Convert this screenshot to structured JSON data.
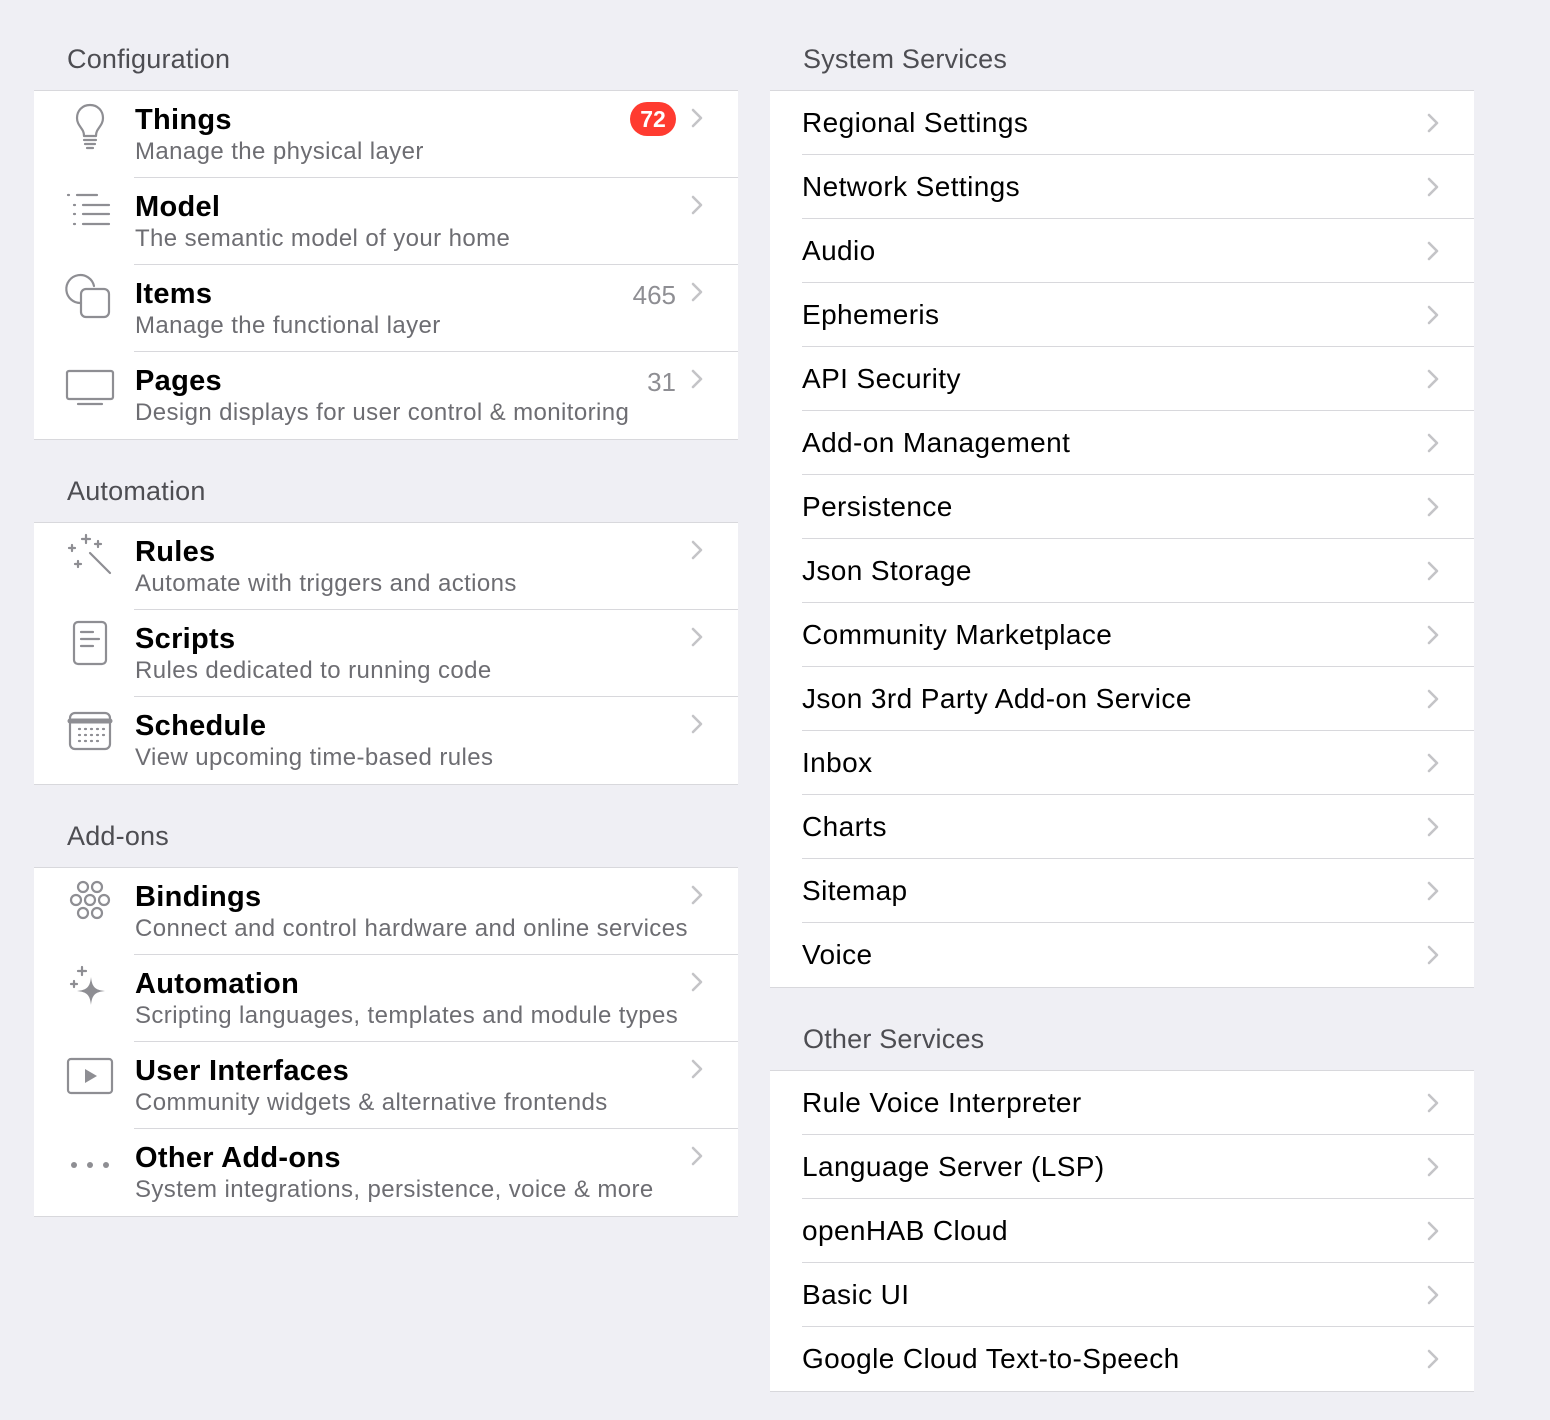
{
  "configuration": {
    "title": "Configuration",
    "items": [
      {
        "title": "Things",
        "subtitle": "Manage the physical layer",
        "badge": "72",
        "after": "",
        "icon": "lightbulb-icon"
      },
      {
        "title": "Model",
        "subtitle": "The semantic model of your home",
        "badge": "",
        "after": "",
        "icon": "list-bullet-indent-icon"
      },
      {
        "title": "Items",
        "subtitle": "Manage the functional layer",
        "badge": "",
        "after": "465",
        "icon": "square-on-circle-icon"
      },
      {
        "title": "Pages",
        "subtitle": "Design displays for user control & monitoring",
        "badge": "",
        "after": "31",
        "icon": "tv-icon"
      }
    ]
  },
  "automation": {
    "title": "Automation",
    "items": [
      {
        "title": "Rules",
        "subtitle": "Automate with triggers and actions",
        "icon": "wand-stars-icon"
      },
      {
        "title": "Scripts",
        "subtitle": "Rules dedicated to running code",
        "icon": "doc-plaintext-icon"
      },
      {
        "title": "Schedule",
        "subtitle": "View upcoming time-based rules",
        "icon": "calendar-icon"
      }
    ]
  },
  "addons": {
    "title": "Add-ons",
    "items": [
      {
        "title": "Bindings",
        "subtitle": "Connect and control hardware and online services",
        "icon": "circles-grid-icon"
      },
      {
        "title": "Automation",
        "subtitle": "Scripting languages, templates and module types",
        "icon": "sparkles-icon"
      },
      {
        "title": "User Interfaces",
        "subtitle": "Community widgets & alternative frontends",
        "icon": "play-rectangle-icon"
      },
      {
        "title": "Other Add-ons",
        "subtitle": "System integrations, persistence, voice & more",
        "icon": "ellipsis-icon"
      }
    ]
  },
  "system_services": {
    "title": "System Services",
    "items": [
      "Regional Settings",
      "Network Settings",
      "Audio",
      "Ephemeris",
      "API Security",
      "Add-on Management",
      "Persistence",
      "Json Storage",
      "Community Marketplace",
      "Json 3rd Party Add-on Service",
      "Inbox",
      "Charts",
      "Sitemap",
      "Voice"
    ]
  },
  "other_services": {
    "title": "Other Services",
    "items": [
      "Rule Voice Interpreter",
      "Language Server (LSP)",
      "openHAB Cloud",
      "Basic UI",
      "Google Cloud Text-to-Speech"
    ]
  },
  "colors": {
    "background": "#efeff4",
    "badge": "#ff3b30",
    "icon": "#8e8e93",
    "secondary_text": "#6d6d72"
  }
}
